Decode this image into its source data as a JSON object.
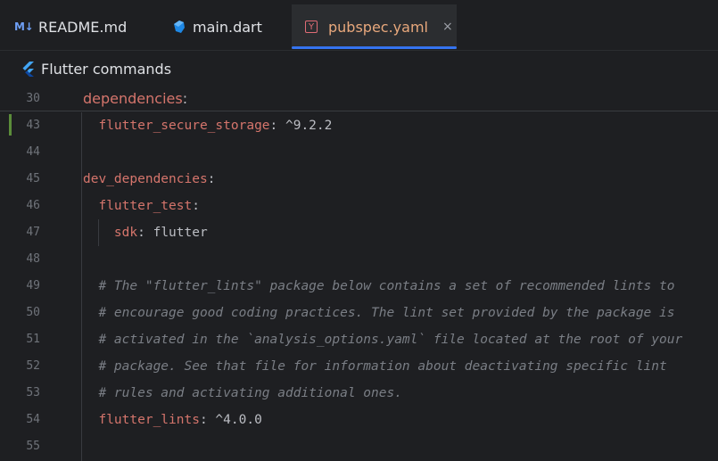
{
  "tabs": [
    {
      "label": "README.md",
      "icon": "markdown-icon",
      "icon_text": "M↓"
    },
    {
      "label": "main.dart",
      "icon": "dart-icon"
    },
    {
      "label": "pubspec.yaml",
      "icon": "yaml-icon",
      "icon_text": "Y",
      "active": true,
      "close": "×"
    }
  ],
  "flutter_bar": {
    "label": "Flutter commands",
    "icon": "flutter-icon"
  },
  "sticky": {
    "line": "30",
    "key": "dependencies",
    "punct": ":"
  },
  "lines": [
    {
      "n": "43",
      "indent": "  ",
      "key": "flutter_secure_storage",
      "punct": ":",
      "val": " ^9.2.2"
    },
    {
      "n": "44"
    },
    {
      "n": "45",
      "indent": "",
      "key": "dev_dependencies",
      "punct": ":"
    },
    {
      "n": "46",
      "indent": "  ",
      "key": "flutter_test",
      "punct": ":"
    },
    {
      "n": "47",
      "indent": "    ",
      "key": "sdk",
      "punct": ":",
      "val": " flutter"
    },
    {
      "n": "48"
    },
    {
      "n": "49",
      "indent": "  ",
      "comment": "# The \"flutter_lints\" package below contains a set of recommended lints to"
    },
    {
      "n": "50",
      "indent": "  ",
      "comment": "# encourage good coding practices. The lint set provided by the package is"
    },
    {
      "n": "51",
      "indent": "  ",
      "comment": "# activated in the `analysis_options.yaml` file located at the root of your"
    },
    {
      "n": "52",
      "indent": "  ",
      "comment": "# package. See that file for information about deactivating specific lint"
    },
    {
      "n": "53",
      "indent": "  ",
      "comment": "# rules and activating additional ones."
    },
    {
      "n": "54",
      "indent": "  ",
      "key": "flutter_lints",
      "punct": ":",
      "val": " ^4.0.0"
    },
    {
      "n": "55"
    }
  ],
  "colors": {
    "background": "#1e1f22",
    "key": "#d5756c",
    "comment": "#7a7e85",
    "accent": "#3574f0",
    "active_tab_label": "#e8a87c",
    "change_marker": "#5b8c3a"
  }
}
